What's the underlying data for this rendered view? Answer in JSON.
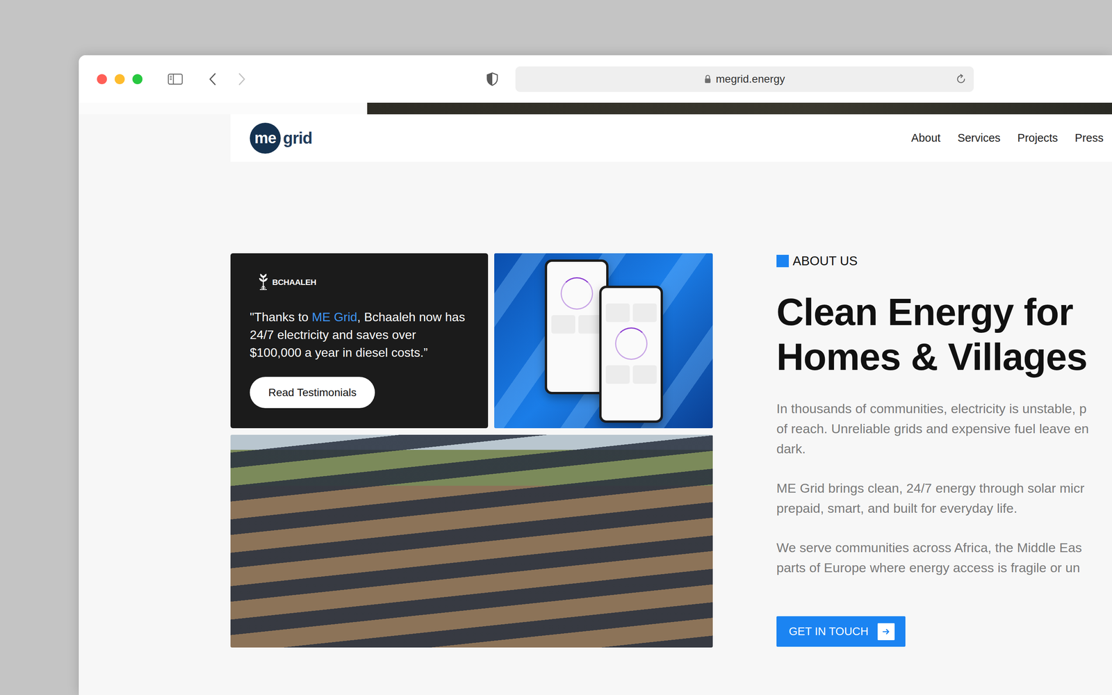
{
  "browser": {
    "url": "megrid.energy",
    "back_enabled": true,
    "forward_enabled": false
  },
  "header": {
    "logo": {
      "mark": "me",
      "word": "grid"
    },
    "nav": [
      "About",
      "Services",
      "Projects",
      "Press"
    ]
  },
  "testimonial": {
    "brand": "BCHAALEH",
    "quote_start": "\"Thanks to ",
    "quote_link": "ME Grid",
    "quote_end": ", Bchaaleh now has 24/7 electricity and saves over $100,000 a year in diesel costs.”",
    "button": "Read Testimonials"
  },
  "about": {
    "eyebrow": "ABOUT US",
    "title_lines": [
      "Clean Energy for",
      "Homes & Villages"
    ],
    "paragraphs": [
      {
        "lines": [
          "In thousands of communities, electricity is unstable, p",
          "of reach. Unreliable grids and expensive fuel leave en",
          "dark."
        ]
      },
      {
        "lines": [
          "ME Grid brings clean, 24/7 energy through solar micr",
          "prepaid, smart, and built for everyday life."
        ]
      },
      {
        "lines": [
          "We serve communities across Africa, the Middle Eas",
          "parts of Europe where energy access is fragile or un"
        ]
      }
    ],
    "button": "GET IN TOUCH"
  }
}
